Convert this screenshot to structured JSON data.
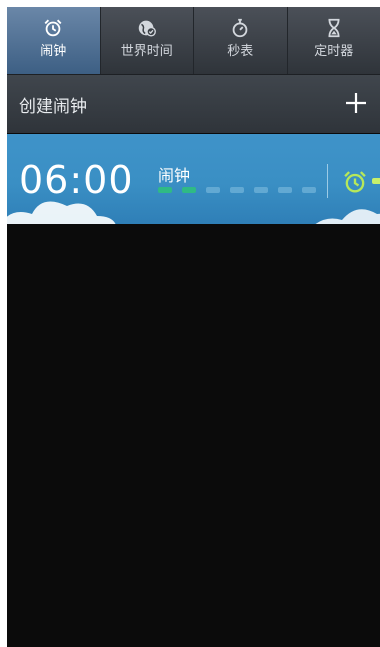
{
  "tabs": [
    {
      "label": "闹钟",
      "icon": "alarm-clock-icon",
      "active": true
    },
    {
      "label": "世界时间",
      "icon": "world-clock-icon",
      "active": false
    },
    {
      "label": "秒表",
      "icon": "stopwatch-icon",
      "active": false
    },
    {
      "label": "定时器",
      "icon": "hourglass-icon",
      "active": false
    }
  ],
  "create_bar": {
    "label": "创建闹钟",
    "add_icon": "plus-icon"
  },
  "alarm": {
    "time": "06:00",
    "name": "闹钟",
    "weekdays_on": [
      true,
      true,
      false,
      false,
      false,
      false,
      false
    ],
    "toggle_icon": "alarm-on-icon"
  },
  "colors": {
    "accent": "#3f93c9",
    "active_tab": "#4f6f93",
    "background": "#0b0b0b",
    "alarm_toggle": "#b6e85a"
  }
}
